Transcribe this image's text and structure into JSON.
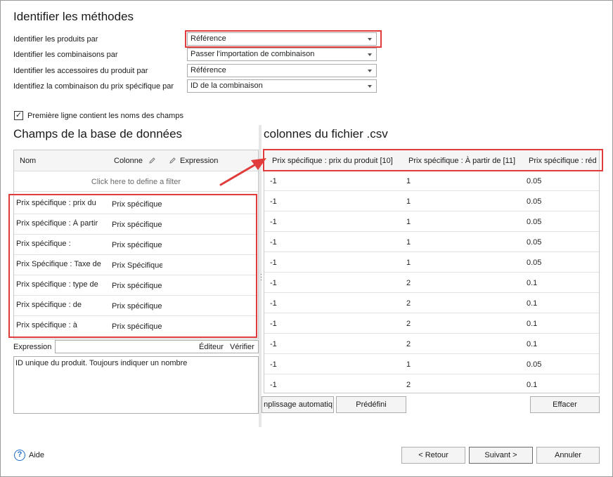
{
  "section_methods": {
    "title": "Identifier les méthodes",
    "rows": [
      {
        "label": "Identifier les produits par",
        "value": "Référence"
      },
      {
        "label": "Identifier les combinaisons par",
        "value": "Passer l'importation de combinaison"
      },
      {
        "label": "Identifier les accessoires du produit par",
        "value": "Référence"
      },
      {
        "label": "Identifiez la combinaison du prix spécifique par",
        "value": "ID de la combinaison"
      }
    ]
  },
  "first_row_option": {
    "label": "Première ligne contient les noms des champs",
    "checked": true,
    "mark": "✓"
  },
  "db_fields": {
    "title": "Champs de la base de données",
    "headers": {
      "name": "Nom",
      "column": "Colonne",
      "expression": "Expression"
    },
    "filter_hint": "Click here to define a filter",
    "rows": [
      {
        "name": "Prix spécifique : prix du",
        "column": "Prix spécifique"
      },
      {
        "name": "Prix spécifique : À partir",
        "column": "Prix spécifique"
      },
      {
        "name": "Prix spécifique :",
        "column": "Prix spécifique"
      },
      {
        "name": "Prix Spécifique : Taxe de",
        "column": "Prix Spécifique"
      },
      {
        "name": "Prix spécifique : type de",
        "column": "Prix spécifique"
      },
      {
        "name": "Prix spécifique : de",
        "column": "Prix spécifique"
      },
      {
        "name": "Prix spécifique : à",
        "column": "Prix spécifique"
      }
    ]
  },
  "expression_bar": {
    "label": "Expression",
    "value": "",
    "editor_label": "Éditeur",
    "verify_label": "Vérifier"
  },
  "description_text": "ID unique du produit. Toujours indiquer un nombre",
  "csv_columns": {
    "title": "colonnes du fichier .csv",
    "headers": [
      "Prix spécifique : prix du produit [10]",
      "Prix spécifique : À partir de [11]",
      "Prix spécifique : réd"
    ],
    "rows": [
      [
        "-1",
        "1",
        "0.05"
      ],
      [
        "-1",
        "1",
        "0.05"
      ],
      [
        "-1",
        "1",
        "0.05"
      ],
      [
        "-1",
        "1",
        "0.05"
      ],
      [
        "-1",
        "1",
        "0.05"
      ],
      [
        "-1",
        "2",
        "0.1"
      ],
      [
        "-1",
        "2",
        "0.1"
      ],
      [
        "-1",
        "2",
        "0.1"
      ],
      [
        "-1",
        "2",
        "0.1"
      ],
      [
        "-1",
        "1",
        "0.05"
      ],
      [
        "-1",
        "2",
        "0.1"
      ]
    ]
  },
  "buttons": {
    "autofill": "nplissage automatiq",
    "predefined": "Prédéfini",
    "clear": "Effacer",
    "back": "< Retour",
    "next": "Suivant >",
    "cancel": "Annuler"
  },
  "help": {
    "label": "Aide",
    "icon": "?"
  },
  "colors": {
    "highlight": "#e03c3c",
    "help_icon": "#1e6fc7"
  }
}
